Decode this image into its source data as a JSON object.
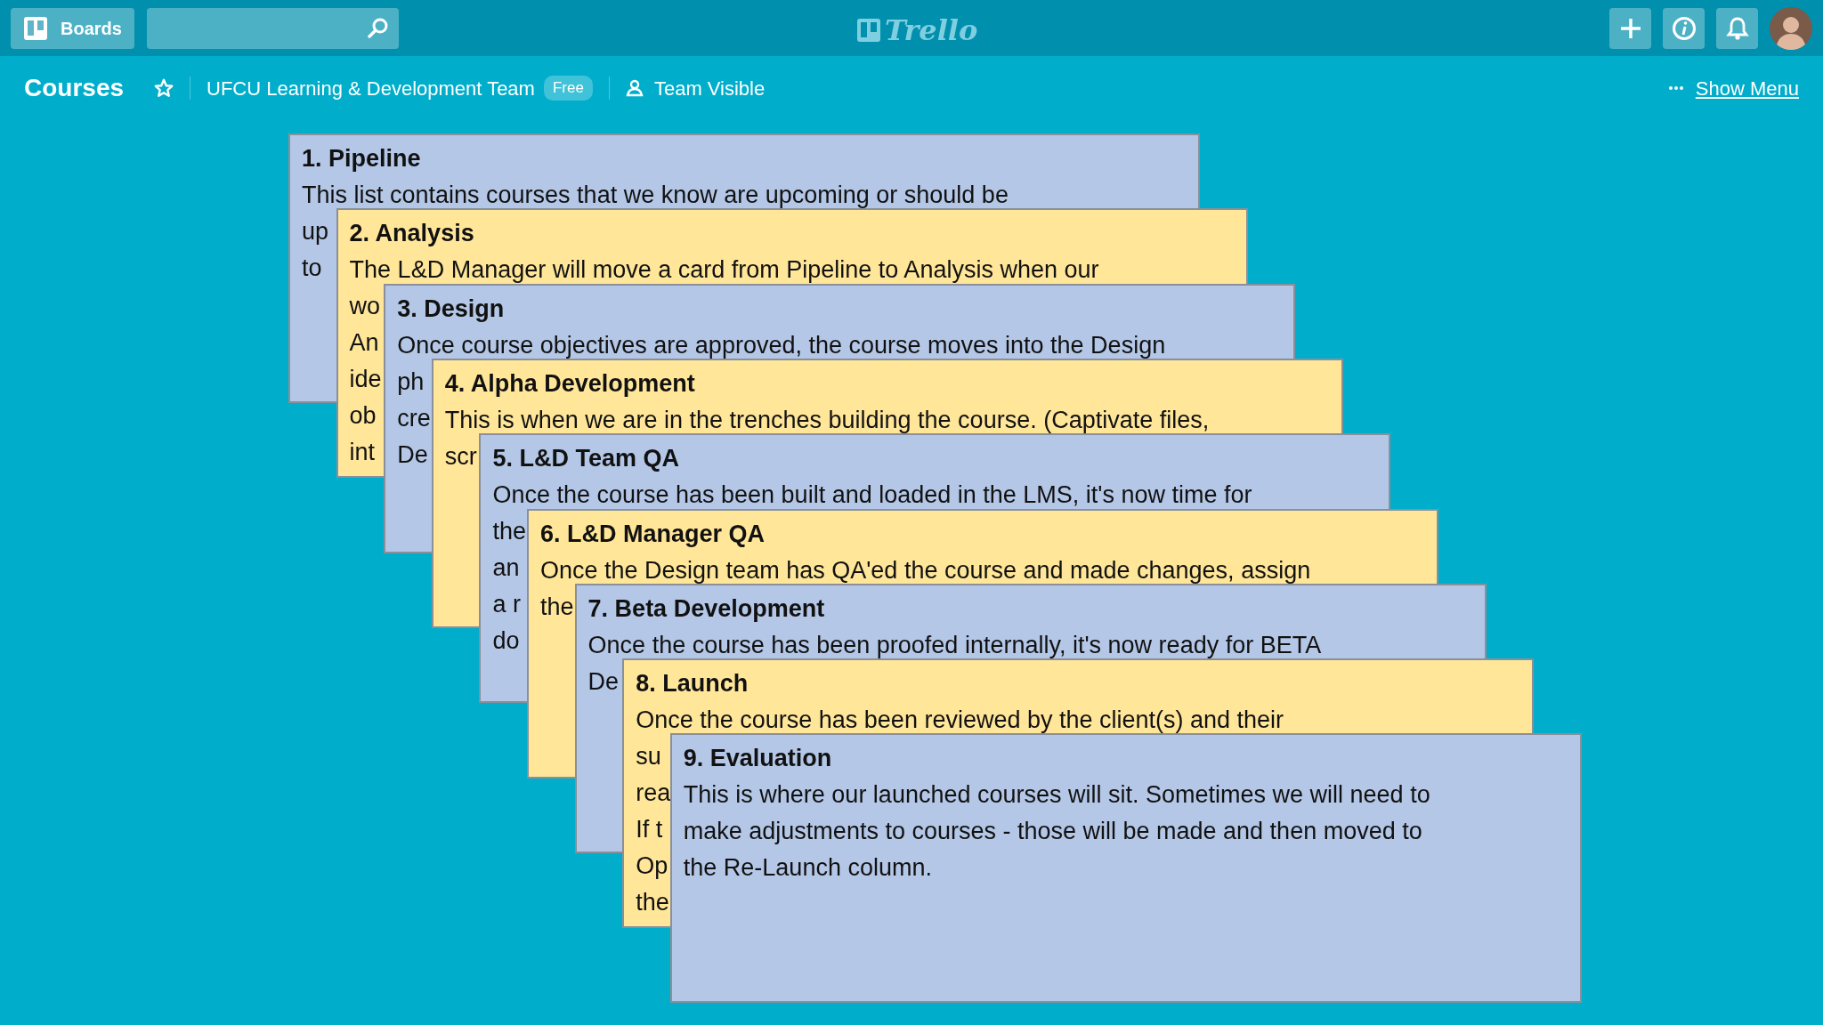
{
  "header": {
    "boards_button": "Boards",
    "logo": "Trello"
  },
  "board": {
    "title": "Courses",
    "team": "UFCU Learning & Development Team",
    "team_badge": "Free",
    "visibility": "Team Visible",
    "menu_link": "Show Menu"
  },
  "cards": [
    {
      "title": "1. Pipeline",
      "color": "#b4c7e7",
      "lines": [
        "This list contains courses that we know are upcoming or should be",
        "up",
        "to"
      ]
    },
    {
      "title": "2. Analysis",
      "color": "#ffe699",
      "lines": [
        "The L&D Manager will move a card from Pipeline to Analysis when our",
        "wo",
        "An",
        "ide",
        "ob",
        "int"
      ]
    },
    {
      "title": "3. Design",
      "color": "#b4c7e7",
      "lines": [
        "Once course objectives are approved, the course moves into the Design",
        "ph",
        "cre",
        "De"
      ]
    },
    {
      "title": "4. Alpha Development",
      "color": "#ffe699",
      "lines": [
        "This is when we are in the trenches building the course. (Captivate files,",
        "scr"
      ]
    },
    {
      "title": "5. L&D Team QA",
      "color": "#b4c7e7",
      "lines": [
        "Once the course has been built and loaded in the LMS, it's now time for",
        "the",
        "an",
        "a r",
        "do"
      ]
    },
    {
      "title": "6. L&D Manager QA",
      "color": "#ffe699",
      "lines": [
        "Once the Design team has QA'ed the course and made changes, assign",
        "the"
      ]
    },
    {
      "title": "7. Beta Development",
      "color": "#b4c7e7",
      "lines": [
        "Once the course has been proofed internally, it's now ready for BETA",
        "De"
      ]
    },
    {
      "title": "8. Launch",
      "color": "#ffe699",
      "lines": [
        "Once the course has been reviewed by the client(s) and their",
        "su",
        "rea",
        "If t",
        "Op",
        "the"
      ]
    },
    {
      "title": "9. Evaluation",
      "color": "#b4c7e7",
      "lines": [
        "This is where our launched courses will sit. Sometimes we will need to",
        "make adjustments to courses - those will be made and then moved to",
        "the Re-Launch column."
      ]
    }
  ]
}
